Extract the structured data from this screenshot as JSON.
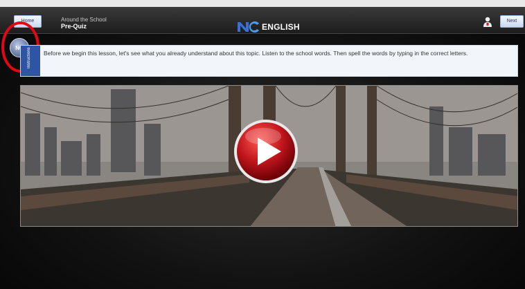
{
  "header": {
    "home_label": "Home",
    "breadcrumb_title": "Around the School",
    "breadcrumb_subtitle": "Pre-Quiz",
    "logo_text": "ENGLISH",
    "logo_mark": "NC",
    "next_label": "Next",
    "user_icon": "user-icon"
  },
  "badge": {
    "label": "NC"
  },
  "instructions": {
    "tab_label": "Instructions",
    "text": "Before we begin this lesson, let's see what you already understand about this topic. Listen to the school words. Then spell the words by typing in the correct letters."
  },
  "video": {
    "play_icon": "play-icon",
    "poster_description_icon": "bridge-poster"
  },
  "colors": {
    "highlight_ring": "#e30613",
    "instruction_tab": "#2e55a4",
    "play_button": "#c0161c"
  }
}
